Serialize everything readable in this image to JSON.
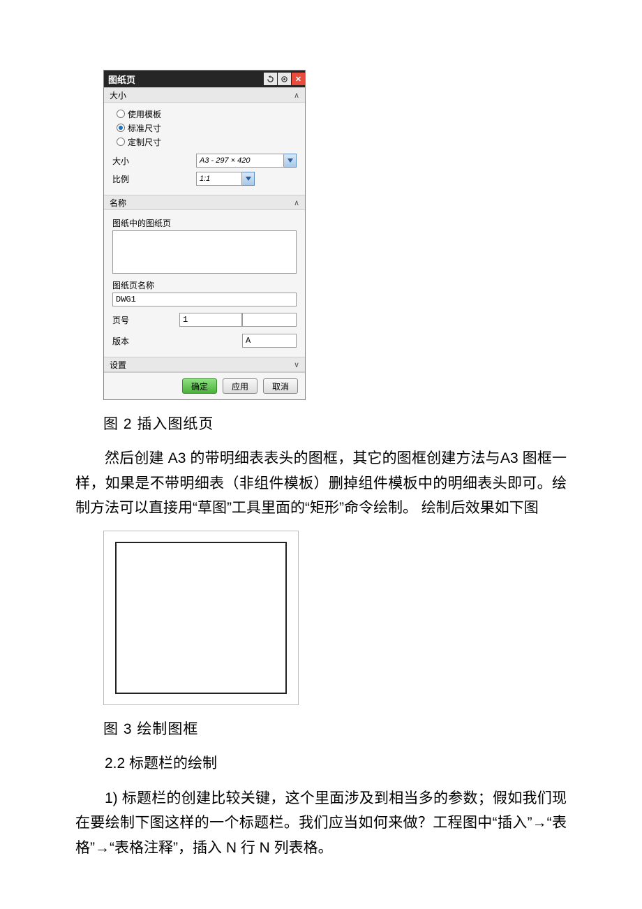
{
  "dialog": {
    "title": "图纸页",
    "sections": {
      "size": {
        "header": "大小",
        "radios": {
          "use_template": "使用模板",
          "standard_size": "标准尺寸",
          "custom_size": "定制尺寸"
        },
        "size_label": "大小",
        "size_value": "A3 - 297 × 420",
        "scale_label": "比例",
        "scale_value": "1:1"
      },
      "name": {
        "header": "名称",
        "sheets_in_drawing": "图纸中的图纸页",
        "sheet_name_label": "图纸页名称",
        "sheet_name_value": "DWG1",
        "page_no_label": "页号",
        "page_no_value": "1",
        "version_label": "版本",
        "version_value": "A"
      },
      "settings": {
        "header": "设置"
      }
    },
    "buttons": {
      "ok": "确定",
      "apply": "应用",
      "cancel": "取消"
    }
  },
  "captions": {
    "fig2": "图 2 插入图纸页",
    "fig3": "图 3 绘制图框"
  },
  "paragraphs": {
    "p1": "然后创建 A3 的带明细表表头的图框，其它的图框创建方法与A3 图框一样，如果是不带明细表（非组件模板）删掉组件模板中的明细表头即可。绘制方法可以直接用“草图”工具里面的“矩形”命令绘制。 绘制后效果如下图",
    "h22": "2.2 标题栏的绘制",
    "p2": "1) 标题栏的创建比较关键，这个里面涉及到相当多的参数；假如我们现在要绘制下图这样的一个标题栏。我们应当如何来做？工程图中“插入”→“表格”→“表格注释”，插入 N 行 N 列表格。"
  }
}
